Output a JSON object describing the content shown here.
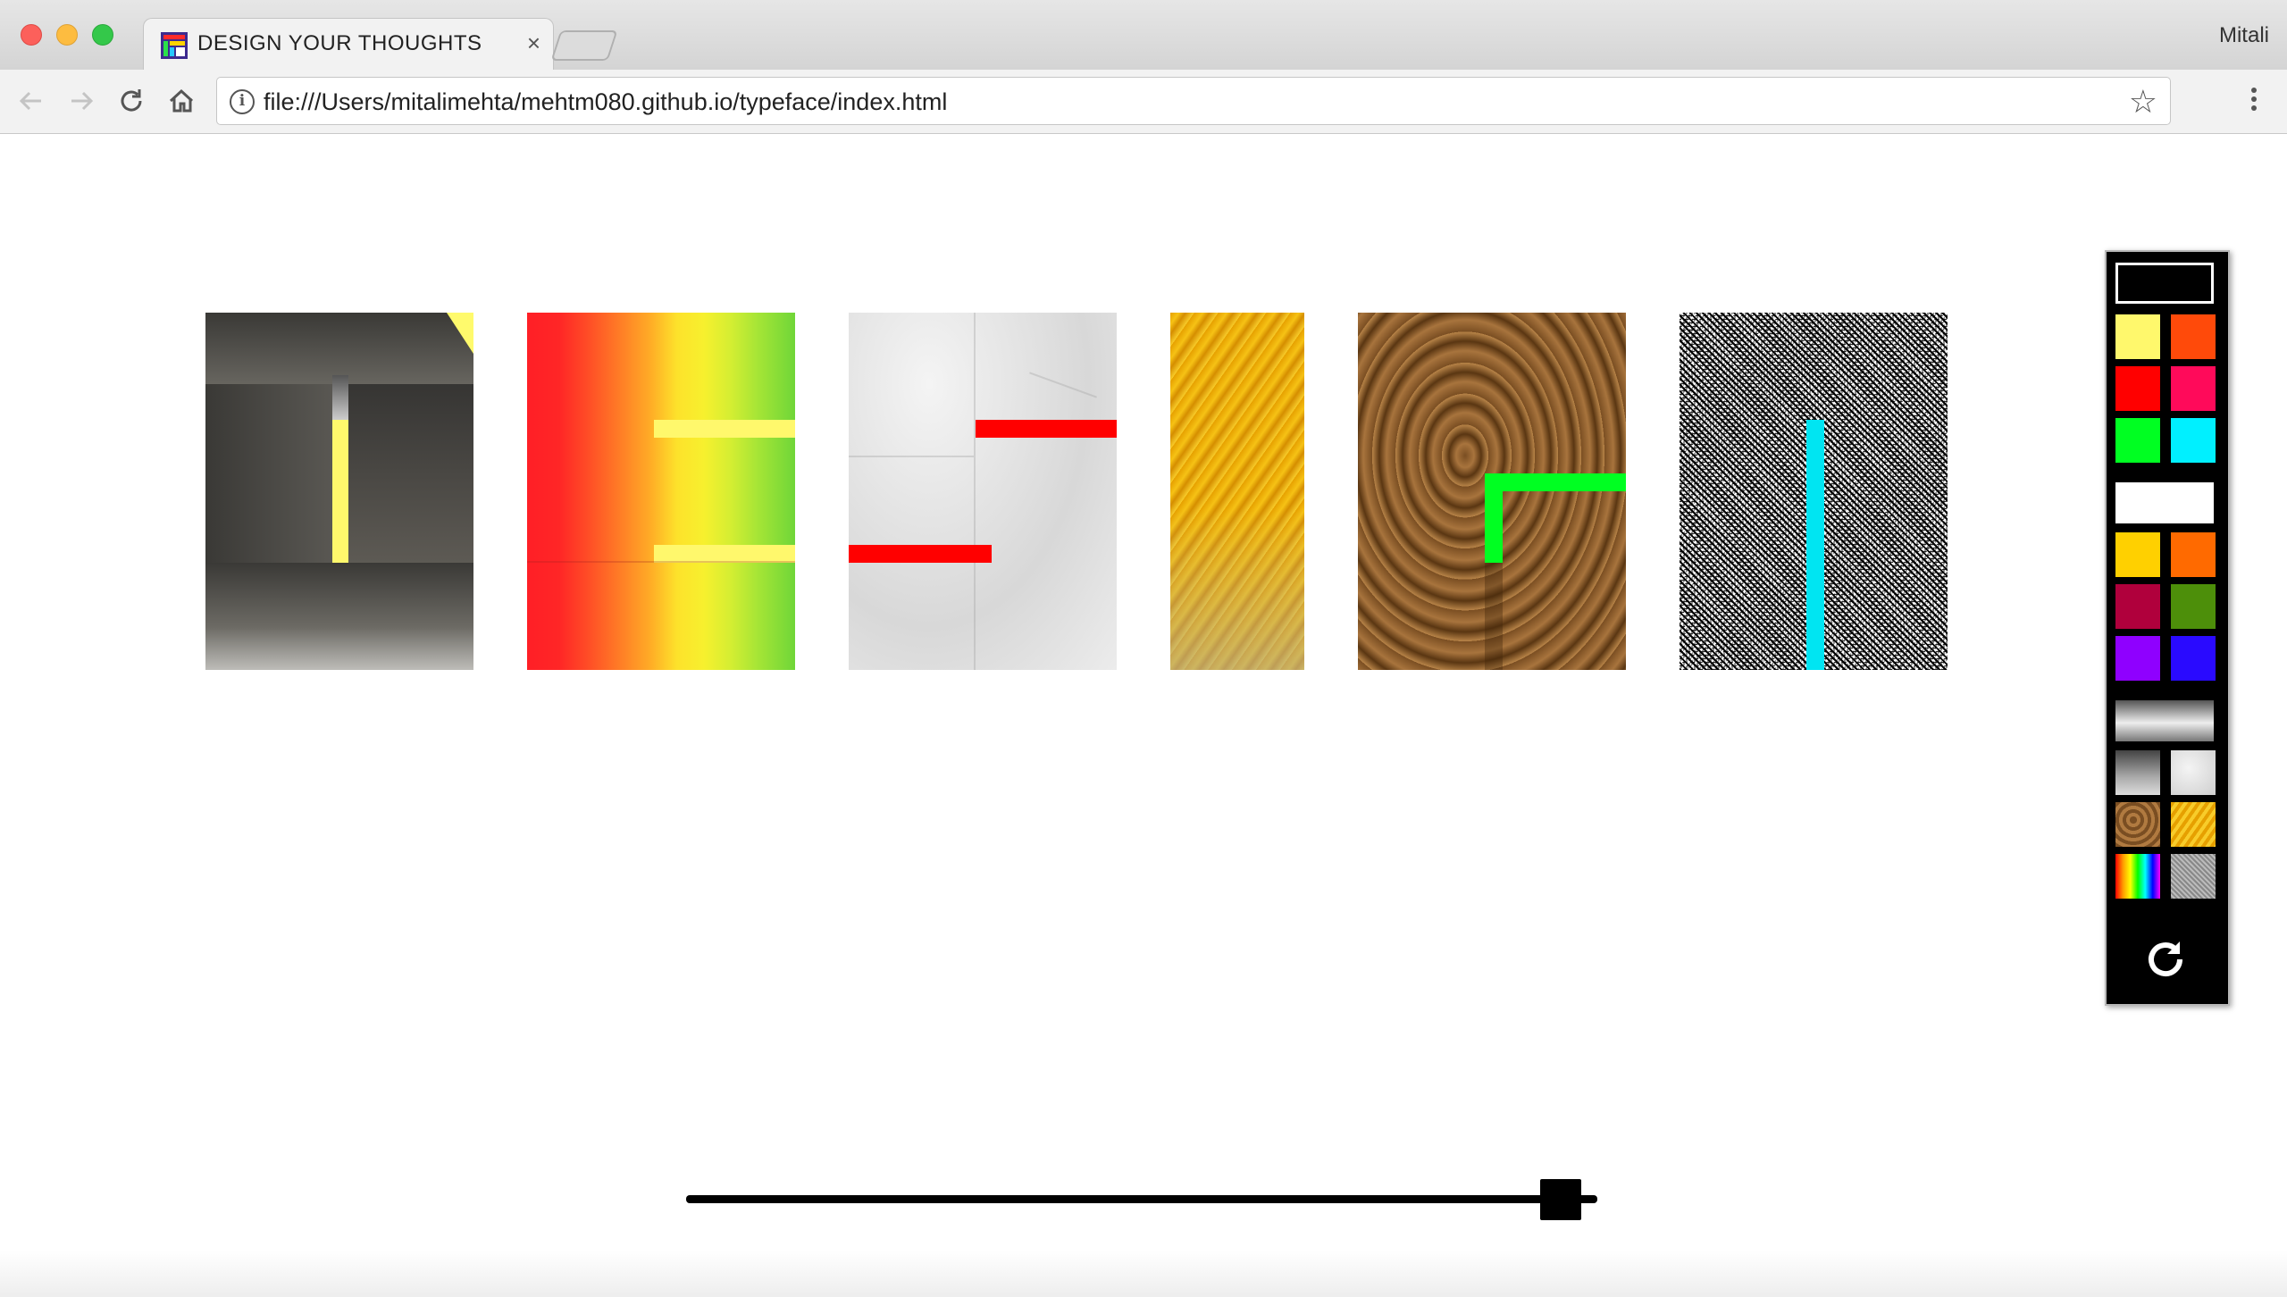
{
  "browser": {
    "tab_title": "DESIGN YOUR THOUGHTS",
    "tab_close": "×",
    "profile_name": "Mitali",
    "url": "file:///Users/mitalimehta/mehtm080.github.io/typeface/index.html",
    "icons": {
      "back": "arrow-left-icon",
      "forward": "arrow-right-icon",
      "reload": "reload-icon",
      "home": "home-icon",
      "info": "info-icon",
      "bookmark": "star-icon",
      "menu": "kebab-menu-icon"
    }
  },
  "letters": [
    {
      "texture": "grey-gradient",
      "stroke_color": "#fff86c"
    },
    {
      "texture": "rainbow",
      "stroke_color": "#fff86c"
    },
    {
      "texture": "crumpled-paper",
      "stroke_color": "#ff0000"
    },
    {
      "texture": "gold",
      "stroke_color": null
    },
    {
      "texture": "brown-fur",
      "stroke_color": "#00ff22"
    },
    {
      "texture": "noise",
      "stroke_color": "#00e5f2"
    }
  ],
  "palette": {
    "colors": [
      "#000000",
      "#fff86c",
      "#ff4a0a",
      "#ff0000",
      "#ff0a5a",
      "#00ff22",
      "#00f0ff",
      "#ffffff",
      "#ffd000",
      "#ff6a00",
      "#b0003c",
      "#4d8f0a",
      "#8f00ff",
      "#2a0aff"
    ],
    "textures": [
      "silver-gradient",
      "grey-gradient",
      "crumpled-paper",
      "brown-fur",
      "gold",
      "rainbow",
      "noise"
    ],
    "reset_icon": "refresh-icon"
  },
  "slider": {
    "value_percent": 96
  }
}
